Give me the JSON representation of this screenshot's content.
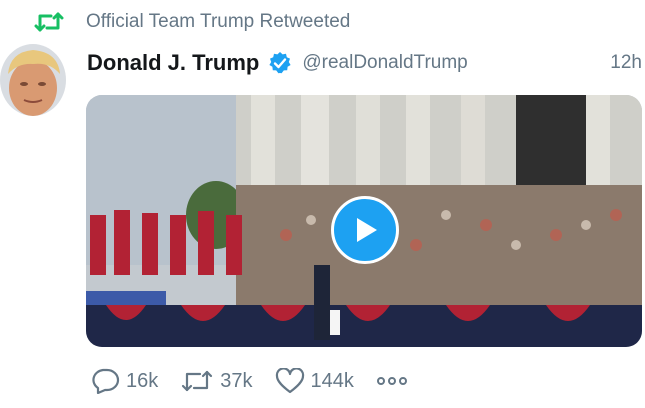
{
  "retweet_header": {
    "icon": "retweet-icon",
    "text": "Official Team Trump Retweeted"
  },
  "author": {
    "name": "Donald J. Trump",
    "handle": "@realDonaldTrump",
    "verified_icon": "verified-badge-icon",
    "avatar": "avatar"
  },
  "timestamp": "12h",
  "media": {
    "type": "video",
    "play_icon": "play-icon"
  },
  "actions": {
    "reply": {
      "icon": "reply-icon",
      "count": "16k"
    },
    "retweet": {
      "icon": "retweet-icon",
      "count": "37k"
    },
    "like": {
      "icon": "heart-icon",
      "count": "144k"
    },
    "more": {
      "icon": "more-icon"
    }
  },
  "colors": {
    "retweet_green": "#17bf63",
    "verified_blue": "#1da1f2",
    "secondary_text": "#657786",
    "primary_text": "#14171a"
  }
}
